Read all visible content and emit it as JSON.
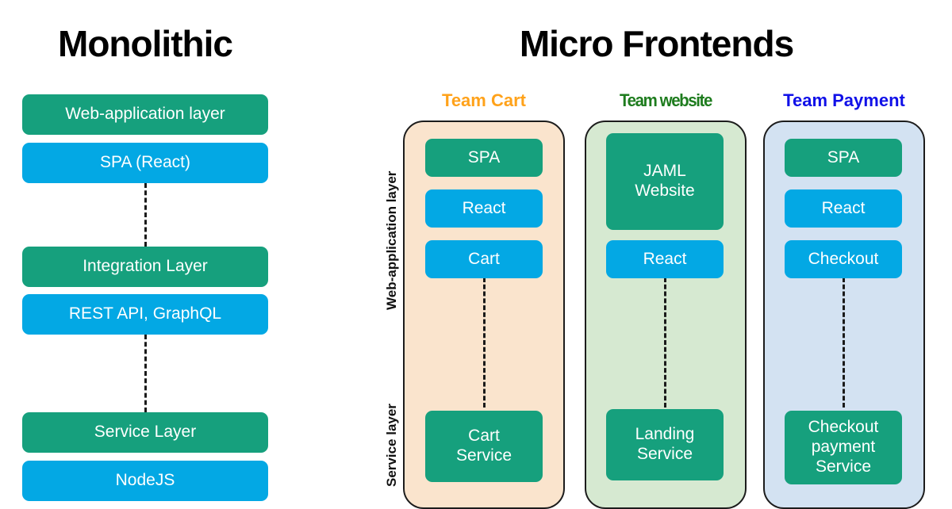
{
  "sections": {
    "monolithic": {
      "title": "Monolithic",
      "boxes": [
        {
          "label": "Web-application layer",
          "color": "green"
        },
        {
          "label": "SPA (React)",
          "color": "blue"
        },
        {
          "label": "Integration Layer",
          "color": "green"
        },
        {
          "label": "REST API, GraphQL",
          "color": "blue"
        },
        {
          "label": "Service Layer",
          "color": "green"
        },
        {
          "label": "NodeJS",
          "color": "blue"
        }
      ]
    },
    "microfrontends": {
      "title": "Micro Frontends",
      "axis_labels": {
        "web": "Web-application layer",
        "service": "Service layer"
      },
      "teams": [
        {
          "heading": "Team Cart",
          "heading_color": "#FFA21A",
          "panel_color": "#FAE4CD",
          "boxes": [
            {
              "label": "SPA",
              "color": "green"
            },
            {
              "label": "React",
              "color": "blue"
            },
            {
              "label": "Cart",
              "color": "blue"
            }
          ],
          "service": {
            "label": "Cart\nService",
            "color": "green"
          }
        },
        {
          "heading": "Team website",
          "heading_color": "#1E7C1E",
          "panel_color": "#D6E9D1",
          "boxes": [
            {
              "label": "JAML\nWebsite",
              "color": "green"
            },
            {
              "label": "React",
              "color": "blue"
            }
          ],
          "service": {
            "label": "Landing\nService",
            "color": "green"
          }
        },
        {
          "heading": "Team Payment",
          "heading_color": "#1010E8",
          "panel_color": "#D3E2F2",
          "boxes": [
            {
              "label": "SPA",
              "color": "green"
            },
            {
              "label": "React",
              "color": "blue"
            },
            {
              "label": "Checkout",
              "color": "blue"
            }
          ],
          "service": {
            "label": "Checkout\npayment\nService",
            "color": "green"
          }
        }
      ]
    }
  },
  "colors": {
    "green": "#16A07D",
    "blue": "#03A8E4",
    "background": "#FFFFFF",
    "connector": "#1A1A1A"
  }
}
